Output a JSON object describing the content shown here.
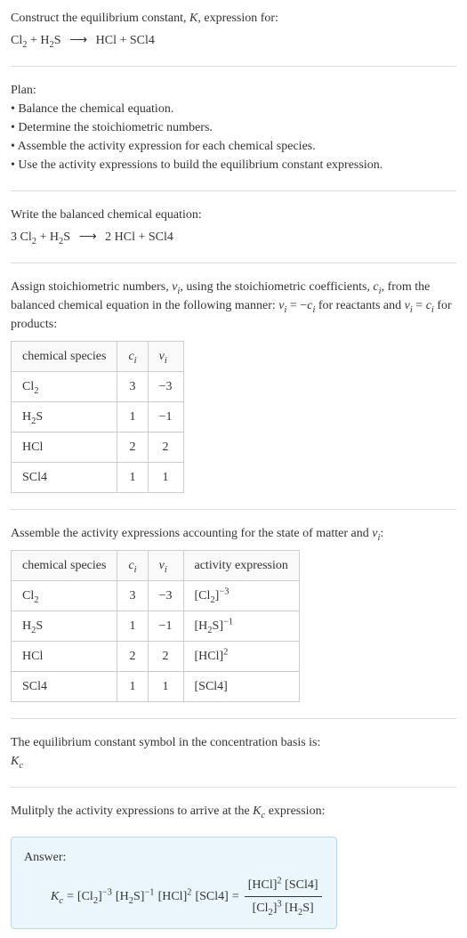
{
  "intro": {
    "title_prefix": "Construct the equilibrium constant, ",
    "title_k": "K",
    "title_suffix": ", expression for:",
    "reaction": {
      "r1": "Cl",
      "r1_sub": "2",
      "plus": " + ",
      "r2": "H",
      "r2_sub": "2",
      "r2_tail": "S",
      "arrow": "⟶",
      "p1": "HCl + SCl4"
    }
  },
  "plan": {
    "title": "Plan:",
    "items": [
      "Balance the chemical equation.",
      "Determine the stoichiometric numbers.",
      "Assemble the activity expression for each chemical species.",
      "Use the activity expressions to build the equilibrium constant expression."
    ]
  },
  "balanced": {
    "title": "Write the balanced chemical equation:",
    "r1_coef": "3 ",
    "r1": "Cl",
    "r1_sub": "2",
    "plus": " + ",
    "r2": "H",
    "r2_sub": "2",
    "r2_tail": "S",
    "arrow": "⟶",
    "p1_coef": "2 ",
    "p1": "HCl + SCl4"
  },
  "stoich": {
    "intro_1": "Assign stoichiometric numbers, ",
    "nu_i": "ν",
    "nu_i_sub": "i",
    "intro_2": ", using the stoichiometric coefficients, ",
    "c_i": "c",
    "c_i_sub": "i",
    "intro_3": ", from the balanced chemical equation in the following manner: ",
    "rule1": "ν",
    "rule1_sub": "i",
    "rule1_eq": " = −",
    "rule1_c": "c",
    "rule1_c_sub": "i",
    "rule1_tail": " for reactants and ",
    "rule2": "ν",
    "rule2_sub": "i",
    "rule2_eq": " = ",
    "rule2_c": "c",
    "rule2_c_sub": "i",
    "rule2_tail": " for products:",
    "headers": {
      "species": "chemical species",
      "c": "c",
      "c_sub": "i",
      "nu": "ν",
      "nu_sub": "i"
    },
    "rows": [
      {
        "sp": "Cl",
        "sp_sub": "2",
        "sp_tail": "",
        "c": "3",
        "nu": "−3"
      },
      {
        "sp": "H",
        "sp_sub": "2",
        "sp_tail": "S",
        "c": "1",
        "nu": "−1"
      },
      {
        "sp": "HCl",
        "sp_sub": "",
        "sp_tail": "",
        "c": "2",
        "nu": "2"
      },
      {
        "sp": "SCl4",
        "sp_sub": "",
        "sp_tail": "",
        "c": "1",
        "nu": "1"
      }
    ]
  },
  "activity": {
    "intro_1": "Assemble the activity expressions accounting for the state of matter and ",
    "nu": "ν",
    "nu_sub": "i",
    "intro_2": ":",
    "headers": {
      "species": "chemical species",
      "c": "c",
      "c_sub": "i",
      "nu": "ν",
      "nu_sub": "i",
      "act": "activity expression"
    },
    "rows": [
      {
        "sp": "Cl",
        "sp_sub": "2",
        "sp_tail": "",
        "c": "3",
        "nu": "−3",
        "act_base": "[Cl",
        "act_sub": "2",
        "act_mid": "]",
        "act_sup": "−3"
      },
      {
        "sp": "H",
        "sp_sub": "2",
        "sp_tail": "S",
        "c": "1",
        "nu": "−1",
        "act_base": "[H",
        "act_sub": "2",
        "act_mid": "S]",
        "act_sup": "−1"
      },
      {
        "sp": "HCl",
        "sp_sub": "",
        "sp_tail": "",
        "c": "2",
        "nu": "2",
        "act_base": "[HCl]",
        "act_sub": "",
        "act_mid": "",
        "act_sup": "2"
      },
      {
        "sp": "SCl4",
        "sp_sub": "",
        "sp_tail": "",
        "c": "1",
        "nu": "1",
        "act_base": "[SCl4]",
        "act_sub": "",
        "act_mid": "",
        "act_sup": ""
      }
    ]
  },
  "symbol": {
    "intro": "The equilibrium constant symbol in the concentration basis is:",
    "K": "K",
    "K_sub": "c"
  },
  "multiply": {
    "intro_1": "Mulitply the activity expressions to arrive at the ",
    "K": "K",
    "K_sub": "c",
    "intro_2": " expression:"
  },
  "answer": {
    "label": "Answer:",
    "lhs_K": "K",
    "lhs_K_sub": "c",
    "eq": " = ",
    "t1": "[Cl",
    "t1_sub": "2",
    "t1_mid": "]",
    "t1_sup": "−3",
    "t2": " [H",
    "t2_sub": "2",
    "t2_mid": "S]",
    "t2_sup": "−1",
    "t3": " [HCl]",
    "t3_sup": "2",
    "t4": " [SCl4]",
    "eq2": " = ",
    "num1": "[HCl]",
    "num1_sup": "2",
    "num2": " [SCl4]",
    "den1": "[Cl",
    "den1_sub": "2",
    "den1_mid": "]",
    "den1_sup": "3",
    "den2": " [H",
    "den2_sub": "2",
    "den2_mid": "S]"
  }
}
